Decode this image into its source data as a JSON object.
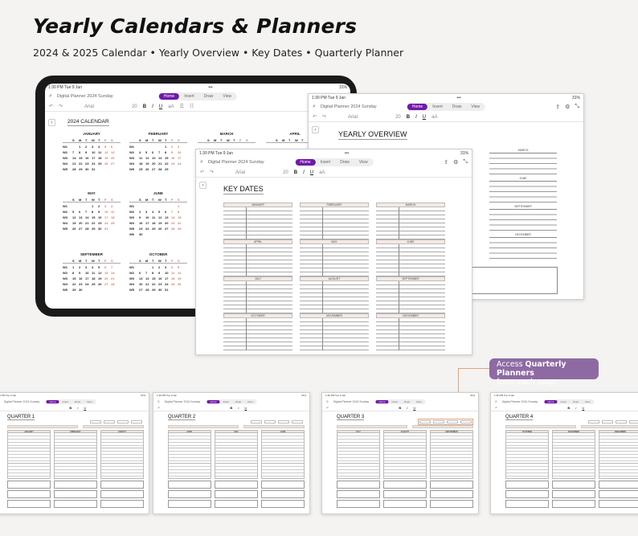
{
  "header": {
    "title": "Yearly Calendars & Planners",
    "subtitle": "2024 & 2025 Calendar • Yearly Overview • Key Dates • Quarterly Planner"
  },
  "app": {
    "status_time": "1:30 PM  Tue 9 Jan",
    "status_dots": "•••",
    "battery": "31%",
    "notebook_title": "Digital Planner 2024 Sunday",
    "tabs": [
      "Home",
      "Insert",
      "Draw",
      "View"
    ],
    "active_tab": "Home",
    "font_name": "Arial",
    "font_size": "20",
    "toolbar": {
      "bold": "B",
      "italic": "I",
      "underline": "U",
      "text_size": "aA",
      "undo": "↶",
      "redo": "↷"
    }
  },
  "calendar_page": {
    "title": "2024 CALENDAR",
    "dow": [
      "S",
      "M",
      "T",
      "W",
      "T",
      "F",
      "S"
    ],
    "week_prefix": "W",
    "months": [
      {
        "name": "JANUARY",
        "weeks": [
          [
            "W1",
            "",
            "1",
            "2",
            "3",
            "4",
            "5",
            "6"
          ],
          [
            "W2",
            "7",
            "8",
            "9",
            "10",
            "11",
            "12",
            "13"
          ],
          [
            "W3",
            "14",
            "15",
            "16",
            "17",
            "18",
            "19",
            "20"
          ],
          [
            "W4",
            "21",
            "22",
            "23",
            "24",
            "25",
            "26",
            "27"
          ],
          [
            "W5",
            "28",
            "29",
            "30",
            "31",
            "",
            "",
            ""
          ]
        ]
      },
      {
        "name": "FEBRUARY",
        "weeks": [
          [
            "W1",
            "",
            "",
            "",
            "",
            "1",
            "2",
            "3"
          ],
          [
            "W2",
            "4",
            "5",
            "6",
            "7",
            "8",
            "9",
            "10"
          ],
          [
            "W3",
            "11",
            "12",
            "13",
            "14",
            "15",
            "16",
            "17"
          ],
          [
            "W4",
            "18",
            "19",
            "20",
            "21",
            "22",
            "23",
            "24"
          ],
          [
            "W5",
            "25",
            "26",
            "27",
            "28",
            "29",
            "",
            ""
          ]
        ]
      },
      {
        "name": "MARCH",
        "weeks": []
      },
      {
        "name": "APRIL",
        "weeks": []
      },
      {
        "name": "MAY",
        "weeks": [
          [
            "W1",
            "",
            "",
            "",
            "1",
            "2",
            "3",
            "4"
          ],
          [
            "W2",
            "5",
            "6",
            "7",
            "8",
            "9",
            "10",
            "11"
          ],
          [
            "W3",
            "12",
            "13",
            "14",
            "15",
            "16",
            "17",
            "18"
          ],
          [
            "W4",
            "19",
            "20",
            "21",
            "22",
            "23",
            "24",
            "25"
          ],
          [
            "W5",
            "26",
            "27",
            "28",
            "29",
            "30",
            "31",
            ""
          ]
        ]
      },
      {
        "name": "JUNE",
        "weeks": [
          [
            "W1",
            "",
            "",
            "",
            "",
            "",
            "",
            "1"
          ],
          [
            "W2",
            "2",
            "3",
            "4",
            "5",
            "6",
            "7",
            "8"
          ],
          [
            "W3",
            "9",
            "10",
            "11",
            "12",
            "13",
            "14",
            "15"
          ],
          [
            "W4",
            "16",
            "17",
            "18",
            "19",
            "20",
            "21",
            "22"
          ],
          [
            "W5",
            "23",
            "24",
            "25",
            "26",
            "27",
            "28",
            "29"
          ],
          [
            "W6",
            "30",
            "",
            "",
            "",
            "",
            "",
            ""
          ]
        ]
      },
      {
        "name": "SEPTEMBER",
        "weeks": [
          [
            "W1",
            "1",
            "2",
            "3",
            "4",
            "5",
            "6",
            "7"
          ],
          [
            "W2",
            "8",
            "9",
            "10",
            "11",
            "12",
            "13",
            "14"
          ],
          [
            "W3",
            "15",
            "16",
            "17",
            "18",
            "19",
            "20",
            "21"
          ],
          [
            "W4",
            "22",
            "23",
            "24",
            "25",
            "26",
            "27",
            "28"
          ],
          [
            "W5",
            "29",
            "30",
            "",
            "",
            "",
            "",
            ""
          ]
        ]
      },
      {
        "name": "OCTOBER",
        "weeks": [
          [
            "W1",
            "",
            "",
            "1",
            "2",
            "3",
            "4",
            "5"
          ],
          [
            "W2",
            "6",
            "7",
            "8",
            "9",
            "10",
            "11",
            "12"
          ],
          [
            "W3",
            "13",
            "14",
            "15",
            "16",
            "17",
            "18",
            "19"
          ],
          [
            "W4",
            "20",
            "21",
            "22",
            "23",
            "24",
            "25",
            "26"
          ],
          [
            "W5",
            "27",
            "28",
            "29",
            "30",
            "31",
            "",
            ""
          ]
        ]
      }
    ]
  },
  "yearly_overview": {
    "title": "YEARLY OVERVIEW",
    "months": [
      "MARCH",
      "JUNE",
      "SEPTEMBER",
      "DECEMBER"
    ]
  },
  "key_dates": {
    "title": "KEY DATES",
    "months": [
      "JANUARY",
      "FEBRUARY",
      "MARCH",
      "APRIL",
      "MAY",
      "JUNE",
      "JULY",
      "AUGUST",
      "SEPTEMBER",
      "OCTOBER",
      "NOVEMBER",
      "DECEMBER"
    ]
  },
  "callout": {
    "text_before": "Access ",
    "text_bold": "Quarterly Planners",
    "text_after": "from each page"
  },
  "quarters": [
    {
      "title": "QUARTER 1",
      "months": [
        "JANUARY",
        "FEBRUARY",
        "MARCH"
      ]
    },
    {
      "title": "QUARTER 2",
      "months": [
        "APRIL",
        "MAY",
        "JUNE"
      ]
    },
    {
      "title": "QUARTER 3",
      "months": [
        "JULY",
        "AUGUST",
        "SEPTEMBER"
      ]
    },
    {
      "title": "QUARTER 4",
      "months": [
        "OCTOBER",
        "NOVEMBER",
        "DECEMBER"
      ]
    }
  ],
  "quarter_tabs": [
    "QUARTER 1",
    "QUARTER 2",
    "QUARTER 3",
    "QUARTER 4"
  ]
}
